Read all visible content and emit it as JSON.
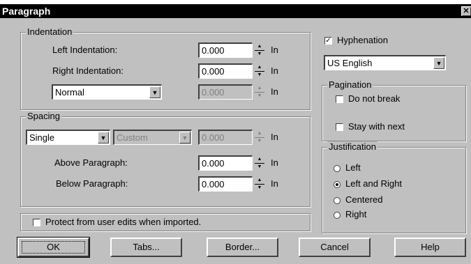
{
  "window": {
    "title": "Paragraph",
    "close_glyph": "✕"
  },
  "indentation": {
    "group_label": "Indentation",
    "left_label": "Left Indentation:",
    "left_value": "0.000",
    "right_label": "Right Indentation:",
    "right_value": "0.000",
    "style_value": "Normal",
    "third_value": "0.000",
    "unit": "In"
  },
  "spacing": {
    "group_label": "Spacing",
    "line_value": "Single",
    "custom_value": "Custom",
    "spacing_value": "0.000",
    "above_label": "Above Paragraph:",
    "above_value": "0.000",
    "below_label": "Below Paragraph:",
    "below_value": "0.000",
    "unit": "In"
  },
  "protect": {
    "label": "Protect from user edits when imported.",
    "checked": false
  },
  "hyphenation": {
    "label": "Hyphenation",
    "checked": true,
    "language": "US English"
  },
  "pagination": {
    "group_label": "Pagination",
    "do_not_break": "Do not break",
    "stay_with_next": "Stay with next"
  },
  "justification": {
    "group_label": "Justification",
    "options": [
      "Left",
      "Left and Right",
      "Centered",
      "Right"
    ],
    "selected": "Left and Right"
  },
  "buttons": {
    "ok": "OK",
    "tabs": "Tabs...",
    "border": "Border...",
    "cancel": "Cancel",
    "help": "Help"
  },
  "icons": {
    "spin_up": "▲",
    "spin_down": "▼",
    "dropdown": "▼",
    "check": "✓"
  }
}
